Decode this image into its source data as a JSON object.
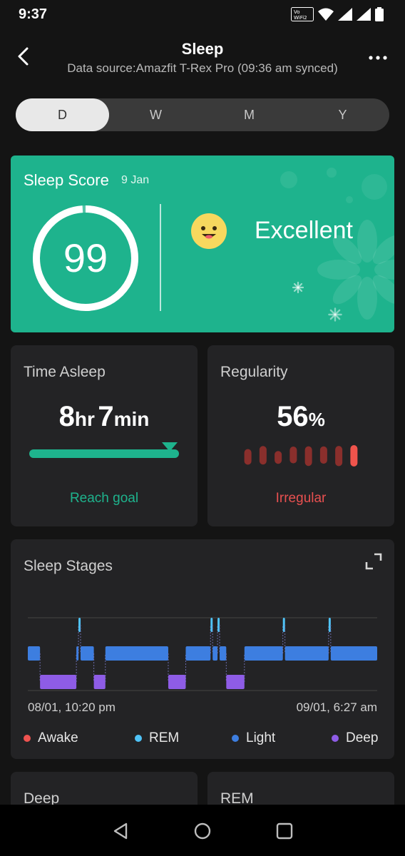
{
  "status_bar": {
    "time": "9:37",
    "network": "Vo WiFi 2"
  },
  "header": {
    "title": "Sleep",
    "subtitle": "Data source:Amazfit T-Rex Pro (09:36 am synced)"
  },
  "period_tabs": [
    {
      "label": "D",
      "active": true
    },
    {
      "label": "W",
      "active": false
    },
    {
      "label": "M",
      "active": false
    },
    {
      "label": "Y",
      "active": false
    }
  ],
  "sleep_score": {
    "title": "Sleep Score",
    "date": "9 Jan",
    "score": "99",
    "score_value": 99,
    "rating": "Excellent"
  },
  "time_asleep": {
    "title": "Time Asleep",
    "hours": "8",
    "hours_unit": "hr",
    "minutes": "7",
    "minutes_unit": "min",
    "goal_text": "Reach goal",
    "goal_progress": 1.0
  },
  "regularity": {
    "title": "Regularity",
    "value": "56",
    "unit": "%",
    "status": "Irregular",
    "bar_levels": [
      0.5,
      0.75,
      0.25,
      0.6,
      0.85,
      0.65,
      0.9,
      1.0
    ]
  },
  "sleep_stages": {
    "title": "Sleep Stages",
    "start_label": "08/01, 10:20 pm",
    "end_label": "09/01, 6:27 am",
    "legend": [
      {
        "name": "Awake",
        "color": "#ef5350"
      },
      {
        "name": "REM",
        "color": "#4fc3f7"
      },
      {
        "name": "Light",
        "color": "#3d7ee0"
      },
      {
        "name": "Deep",
        "color": "#8e5ce6"
      }
    ],
    "stage_order": [
      "Awake",
      "REM",
      "Light",
      "Deep"
    ],
    "timeline": [
      {
        "stage": "Light",
        "start": 0.0,
        "end": 0.035
      },
      {
        "stage": "Deep",
        "start": 0.035,
        "end": 0.139
      },
      {
        "stage": "Light",
        "start": 0.139,
        "end": 0.145
      },
      {
        "stage": "REM",
        "start": 0.145,
        "end": 0.151
      },
      {
        "stage": "Light",
        "start": 0.151,
        "end": 0.189
      },
      {
        "stage": "Deep",
        "start": 0.189,
        "end": 0.222
      },
      {
        "stage": "Light",
        "start": 0.222,
        "end": 0.402
      },
      {
        "stage": "Deep",
        "start": 0.402,
        "end": 0.452
      },
      {
        "stage": "Light",
        "start": 0.452,
        "end": 0.523
      },
      {
        "stage": "REM",
        "start": 0.523,
        "end": 0.529
      },
      {
        "stage": "Light",
        "start": 0.529,
        "end": 0.543
      },
      {
        "stage": "REM",
        "start": 0.543,
        "end": 0.549
      },
      {
        "stage": "Light",
        "start": 0.549,
        "end": 0.568
      },
      {
        "stage": "Deep",
        "start": 0.568,
        "end": 0.62
      },
      {
        "stage": "Light",
        "start": 0.62,
        "end": 0.73
      },
      {
        "stage": "REM",
        "start": 0.73,
        "end": 0.736
      },
      {
        "stage": "Light",
        "start": 0.736,
        "end": 0.861
      },
      {
        "stage": "REM",
        "start": 0.861,
        "end": 0.867
      },
      {
        "stage": "Light",
        "start": 0.867,
        "end": 1.0
      }
    ]
  },
  "bottom_cards": {
    "left_title": "Deep",
    "right_title": "REM"
  }
}
